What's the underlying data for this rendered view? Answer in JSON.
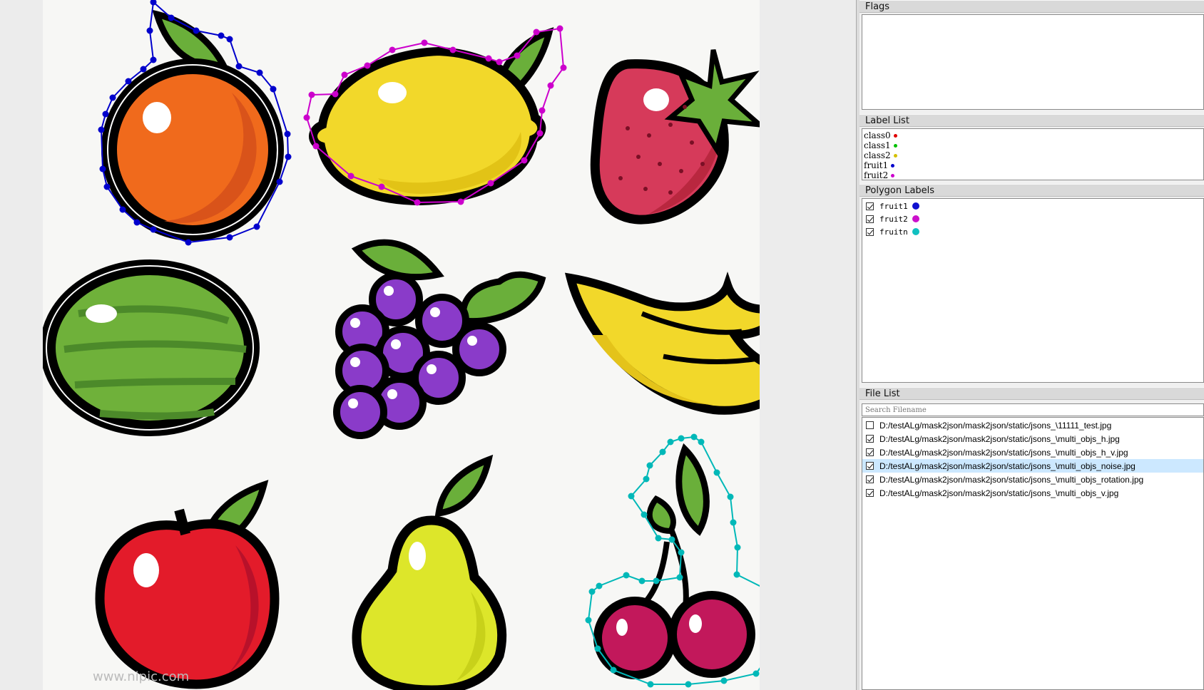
{
  "canvas": {
    "fruits": [
      {
        "name": "orange",
        "color": "#f06a1c",
        "shade": "#d9531a"
      },
      {
        "name": "lemon",
        "color": "#f2d82a",
        "shade": "#e2c316"
      },
      {
        "name": "strawberry",
        "color": "#d63a5a",
        "shade": "#b9273f"
      },
      {
        "name": "watermelon",
        "color": "#6fb13a",
        "shade": "#4c8a2a"
      },
      {
        "name": "grapes",
        "color": "#8a3bc9",
        "shade": "#6a2aa0"
      },
      {
        "name": "banana",
        "color": "#f2d82a",
        "shade": "#e4c31a"
      },
      {
        "name": "apple",
        "color": "#e31b2a",
        "shade": "#b8112a"
      },
      {
        "name": "pear",
        "color": "#dde62a",
        "shade": "#c8d11a"
      },
      {
        "name": "cherries",
        "color": "#c2185b",
        "shade": "#9c1049"
      }
    ],
    "leaf_color": "#6aaf3a",
    "watermark": "www.nipic.com"
  },
  "polygons": [
    {
      "label": "fruit1",
      "color": "#0000cc"
    },
    {
      "label": "fruit2",
      "color": "#cc00cc"
    },
    {
      "label": "fruitn",
      "color": "#00b8b8"
    }
  ],
  "dock": {
    "flags": {
      "title": "Flags"
    },
    "label_list": {
      "title": "Label List",
      "items": [
        {
          "label": "class0",
          "color": "#e00000"
        },
        {
          "label": "class1",
          "color": "#00c000"
        },
        {
          "label": "class2",
          "color": "#d4c000"
        },
        {
          "label": "fruit1",
          "color": "#0000cc"
        },
        {
          "label": "fruit2",
          "color": "#cc00cc"
        }
      ]
    },
    "polygon_labels": {
      "title": "Polygon Labels",
      "items": [
        {
          "label": "fruit1",
          "color": "#1010d0",
          "checked": true
        },
        {
          "label": "fruit2",
          "color": "#cc10cc",
          "checked": true
        },
        {
          "label": "fruitn",
          "color": "#10c0c0",
          "checked": true
        }
      ]
    },
    "file_list": {
      "title": "File List",
      "search_placeholder": "Search Filename",
      "files": [
        {
          "path": "D:/testALg/mask2json/mask2json/static/jsons_\\11111_test.jpg",
          "checked": false,
          "selected": false
        },
        {
          "path": "D:/testALg/mask2json/mask2json/static/jsons_\\multi_objs_h.jpg",
          "checked": true,
          "selected": false
        },
        {
          "path": "D:/testALg/mask2json/mask2json/static/jsons_\\multi_objs_h_v.jpg",
          "checked": true,
          "selected": false
        },
        {
          "path": "D:/testALg/mask2json/mask2json/static/jsons_\\multi_objs_noise.jpg",
          "checked": true,
          "selected": true
        },
        {
          "path": "D:/testALg/mask2json/mask2json/static/jsons_\\multi_objs_rotation.jpg",
          "checked": true,
          "selected": false
        },
        {
          "path": "D:/testALg/mask2json/mask2json/static/jsons_\\multi_objs_v.jpg",
          "checked": true,
          "selected": false
        }
      ]
    }
  }
}
